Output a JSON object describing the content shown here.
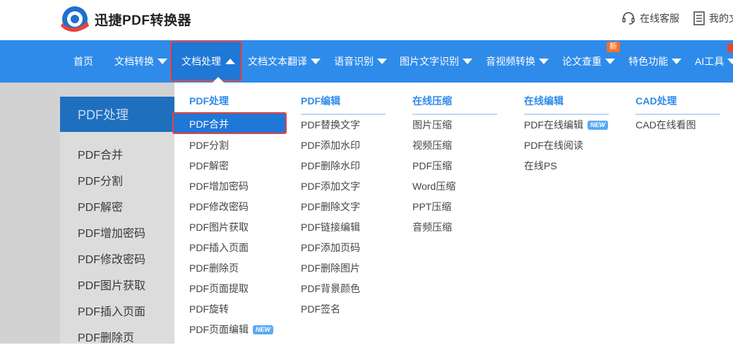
{
  "header": {
    "logo_text": "迅捷PDF转换器",
    "service_label": "在线客服",
    "mine_label": "我的文"
  },
  "nav": {
    "items": [
      {
        "label": "首页"
      },
      {
        "label": "文档转换"
      },
      {
        "label": "文档处理"
      },
      {
        "label": "文档文本翻译"
      },
      {
        "label": "语音识别"
      },
      {
        "label": "图片文字识别"
      },
      {
        "label": "音视频转换"
      },
      {
        "label": "论文查重"
      },
      {
        "label": "特色功能"
      },
      {
        "label": "AI工具"
      }
    ],
    "new_badge": "新"
  },
  "sidebar": {
    "heading": "PDF处理",
    "items": [
      "PDF合并",
      "PDF分割",
      "PDF解密",
      "PDF增加密码",
      "PDF修改密码",
      "PDF图片获取",
      "PDF插入页面",
      "PDF删除页"
    ]
  },
  "dropdown": {
    "columns": [
      {
        "heading": "PDF处理",
        "items": [
          "PDF合并",
          "PDF分割",
          "PDF解密",
          "PDF增加密码",
          "PDF修改密码",
          "PDF图片获取",
          "PDF插入页面",
          "PDF删除页",
          "PDF页面提取",
          "PDF旋转",
          "PDF页面编辑"
        ]
      },
      {
        "heading": "PDF编辑",
        "items": [
          "PDF替换文字",
          "PDF添加水印",
          "PDF删除水印",
          "PDF添加文字",
          "PDF删除文字",
          "PDF链接编辑",
          "PDF添加页码",
          "PDF删除图片",
          "PDF背景颜色",
          "PDF签名"
        ]
      },
      {
        "heading": "在线压缩",
        "items": [
          "图片压缩",
          "视频压缩",
          "PDF压缩",
          "Word压缩",
          "PPT压缩",
          "音频压缩"
        ]
      },
      {
        "heading": "在线编辑",
        "items": [
          "PDF在线编辑",
          "PDF在线阅读",
          "在线PS"
        ]
      },
      {
        "heading": "CAD处理",
        "items": [
          "CAD在线看图"
        ]
      }
    ],
    "new_tag": "NEW"
  },
  "colors": {
    "nav_blue": "#2f8bea",
    "active_blue": "#1f77d6",
    "highlight_red": "#e8433a",
    "badge_orange": "#f0712b"
  }
}
